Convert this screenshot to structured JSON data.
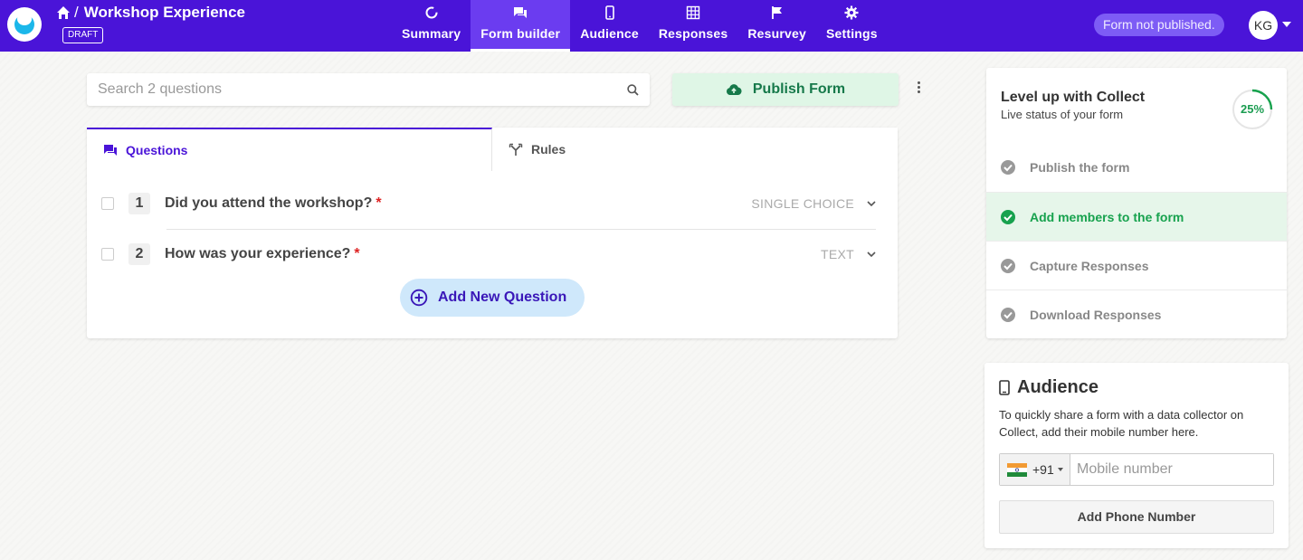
{
  "header": {
    "title": "Workshop Experience",
    "separator": "/",
    "badge": "DRAFT",
    "nav": [
      {
        "label": "Summary",
        "icon": "summary-ring-icon",
        "active": false
      },
      {
        "label": "Form builder",
        "icon": "chat-icon",
        "active": true
      },
      {
        "label": "Audience",
        "icon": "mobile-icon",
        "active": false
      },
      {
        "label": "Responses",
        "icon": "grid-icon",
        "active": false
      },
      {
        "label": "Resurvey",
        "icon": "flag-icon",
        "active": false
      },
      {
        "label": "Settings",
        "icon": "gear-icon",
        "active": false
      }
    ],
    "publish_status": "Form not published.",
    "avatar_initials": "KG",
    "brand_color": "#4a14d8"
  },
  "toolbar": {
    "search_placeholder": "Search 2 questions",
    "publish_label": "Publish Form"
  },
  "questions_card": {
    "tabs": [
      {
        "label": "Questions",
        "active": true
      },
      {
        "label": "Rules",
        "active": false
      }
    ],
    "questions": [
      {
        "number": "1",
        "text": "Did you attend the workshop?",
        "required": "*",
        "type": "SINGLE CHOICE"
      },
      {
        "number": "2",
        "text": "How was your experience?",
        "required": "*",
        "type": "TEXT"
      }
    ],
    "add_label": "Add New Question"
  },
  "progress": {
    "title": "Level up with Collect",
    "subtitle": "Live status of your form",
    "percent_label": "25%",
    "percent_value": 0.25,
    "steps": [
      {
        "label": "Publish the form",
        "done": false
      },
      {
        "label": "Add members to the form",
        "done": true
      },
      {
        "label": "Capture Responses",
        "done": false
      },
      {
        "label": "Download Responses",
        "done": false
      }
    ],
    "accent": "#17a24e"
  },
  "audience": {
    "title": "Audience",
    "description": "To quickly share a form with a data collector on Collect, add their mobile number here.",
    "country_code": "+91",
    "phone_placeholder": "Mobile number",
    "add_button": "Add Phone Number"
  }
}
